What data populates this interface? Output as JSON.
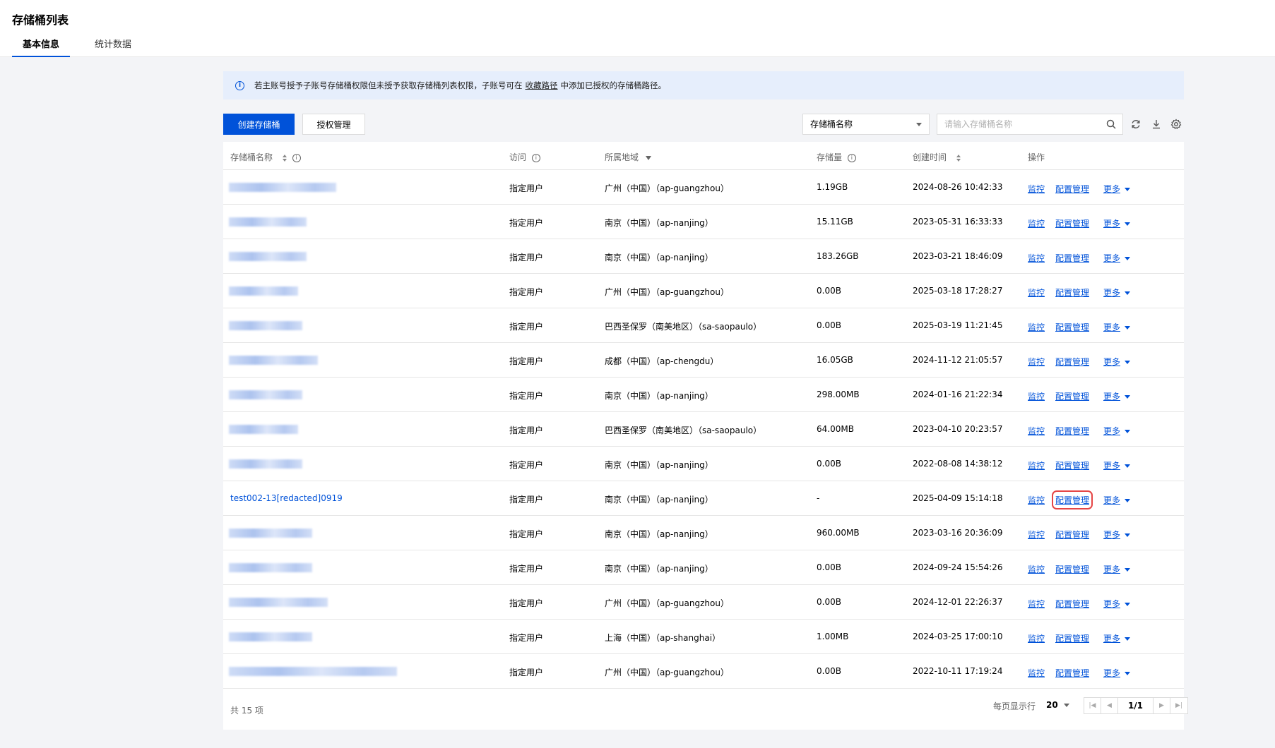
{
  "page": {
    "title": "存储桶列表",
    "tabs": [
      "基本信息",
      "统计数据"
    ]
  },
  "notice": {
    "text_before": "若主账号授予子账号存储桶权限但未授予获取存储桶列表权限，子账号可在",
    "link": "收藏路径",
    "text_after": "中添加已授权的存储桶路径。"
  },
  "toolbar": {
    "create_label": "创建存储桶",
    "auth_label": "授权管理",
    "select_value": "存储桶名称",
    "search_placeholder": "请输入存储桶名称"
  },
  "table": {
    "headers": {
      "name": "存储桶名称",
      "access": "访问",
      "region": "所属地域",
      "storage": "存储量",
      "created": "创建时间",
      "ops": "操作"
    },
    "ops": {
      "monitor": "监控",
      "config": "配置管理",
      "more": "更多"
    },
    "rows": [
      {
        "name": "",
        "access": "指定用户",
        "region": "广州（中国）（ap-guangzhou）",
        "storage": "1.19GB",
        "created": "2024-08-26 10:42:33"
      },
      {
        "name": "",
        "access": "指定用户",
        "region": "南京（中国）（ap-nanjing）",
        "storage": "15.11GB",
        "created": "2023-05-31 16:33:33"
      },
      {
        "name": "",
        "access": "指定用户",
        "region": "南京（中国）（ap-nanjing）",
        "storage": "183.26GB",
        "created": "2023-03-21 18:46:09"
      },
      {
        "name": "",
        "access": "指定用户",
        "region": "广州（中国）（ap-guangzhou）",
        "storage": "0.00B",
        "created": "2025-03-18 17:28:27"
      },
      {
        "name": "",
        "access": "指定用户",
        "region": "巴西圣保罗（南美地区）（sa-saopaulo）",
        "storage": "0.00B",
        "created": "2025-03-19 11:21:45"
      },
      {
        "name": "",
        "access": "指定用户",
        "region": "成都（中国）（ap-chengdu）",
        "storage": "16.05GB",
        "created": "2024-11-12 21:05:57"
      },
      {
        "name": "",
        "access": "指定用户",
        "region": "南京（中国）（ap-nanjing）",
        "storage": "298.00MB",
        "created": "2024-01-16 21:22:34"
      },
      {
        "name": "",
        "access": "指定用户",
        "region": "巴西圣保罗（南美地区）（sa-saopaulo）",
        "storage": "64.00MB",
        "created": "2023-04-10 20:23:57"
      },
      {
        "name": "",
        "access": "指定用户",
        "region": "南京（中国）（ap-nanjing）",
        "storage": "0.00B",
        "created": "2022-08-08 14:38:12"
      },
      {
        "name": "test002-13[redacted]0919",
        "access": "指定用户",
        "region": "南京（中国）（ap-nanjing）",
        "storage": "-",
        "created": "2025-04-09 15:14:18"
      },
      {
        "name": "",
        "access": "指定用户",
        "region": "南京（中国）（ap-nanjing）",
        "storage": "960.00MB",
        "created": "2023-03-16 20:36:09"
      },
      {
        "name": "",
        "access": "指定用户",
        "region": "南京（中国）（ap-nanjing）",
        "storage": "0.00B",
        "created": "2024-09-24 15:54:26"
      },
      {
        "name": "",
        "access": "指定用户",
        "region": "广州（中国）（ap-guangzhou）",
        "storage": "0.00B",
        "created": "2024-12-01 22:26:37"
      },
      {
        "name": "",
        "access": "指定用户",
        "region": "上海（中国）（ap-shanghai）",
        "storage": "1.00MB",
        "created": "2024-03-25 17:00:10"
      },
      {
        "name": "",
        "access": "指定用户",
        "region": "广州（中国）（ap-guangzhou）",
        "storage": "0.00B",
        "created": "2022-10-11 17:19:24"
      }
    ]
  },
  "footer": {
    "total": "共 15 项",
    "per_page_label": "每页显示行",
    "per_page_value": "20",
    "page": "1/1"
  },
  "colors": {
    "accent": "#0052d9",
    "highlight": "#e54545",
    "notice_bg": "#e6eefc"
  }
}
